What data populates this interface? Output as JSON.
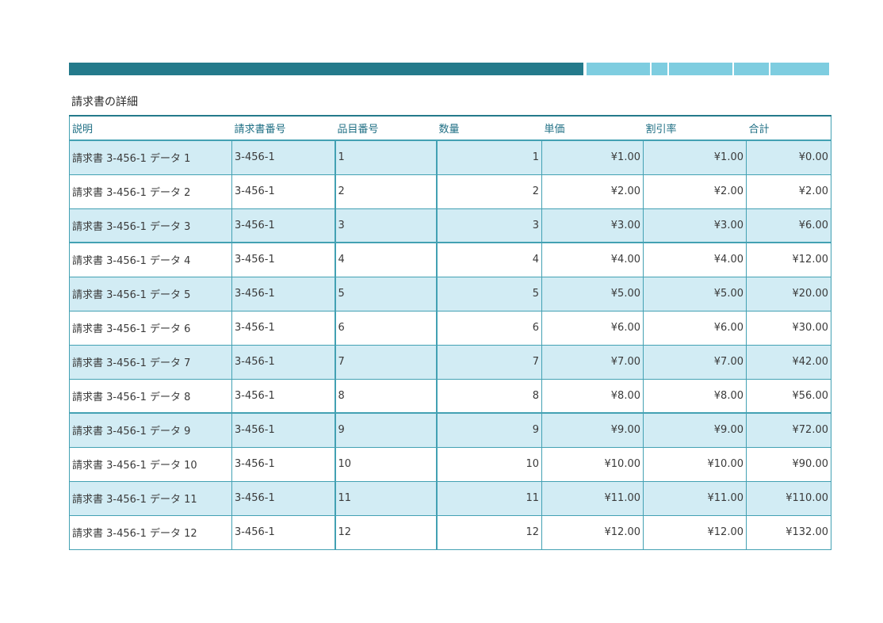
{
  "section": {
    "title": "請求書の詳細"
  },
  "table": {
    "headers": [
      "説明",
      "請求書番号",
      "品目番号",
      "数量",
      "単価",
      "割引率",
      "合計"
    ],
    "rows": [
      [
        "請求書 3-456-1 データ 1",
        "3-456-1",
        "1",
        "1",
        "¥1.00",
        "¥1.00",
        "¥0.00"
      ],
      [
        "請求書 3-456-1 データ 2",
        "3-456-1",
        "2",
        "2",
        "¥2.00",
        "¥2.00",
        "¥2.00"
      ],
      [
        "請求書 3-456-1 データ 3",
        "3-456-1",
        "3",
        "3",
        "¥3.00",
        "¥3.00",
        "¥6.00"
      ],
      [
        "請求書 3-456-1 データ 4",
        "3-456-1",
        "4",
        "4",
        "¥4.00",
        "¥4.00",
        "¥12.00"
      ],
      [
        "請求書 3-456-1 データ 5",
        "3-456-1",
        "5",
        "5",
        "¥5.00",
        "¥5.00",
        "¥20.00"
      ],
      [
        "請求書 3-456-1 データ 6",
        "3-456-1",
        "6",
        "6",
        "¥6.00",
        "¥6.00",
        "¥30.00"
      ],
      [
        "請求書 3-456-1 データ 7",
        "3-456-1",
        "7",
        "7",
        "¥7.00",
        "¥7.00",
        "¥42.00"
      ],
      [
        "請求書 3-456-1 データ 8",
        "3-456-1",
        "8",
        "8",
        "¥8.00",
        "¥8.00",
        "¥56.00"
      ],
      [
        "請求書 3-456-1 データ 9",
        "3-456-1",
        "9",
        "9",
        "¥9.00",
        "¥9.00",
        "¥72.00"
      ],
      [
        "請求書 3-456-1 データ 10",
        "3-456-1",
        "10",
        "10",
        "¥10.00",
        "¥10.00",
        "¥90.00"
      ],
      [
        "請求書 3-456-1 データ 11",
        "3-456-1",
        "11",
        "11",
        "¥11.00",
        "¥11.00",
        "¥110.00"
      ],
      [
        "請求書 3-456-1 データ 12",
        "3-456-1",
        "12",
        "12",
        "¥12.00",
        "¥12.00",
        "¥132.00"
      ]
    ]
  },
  "colors": {
    "accent_dark": "#247a8b",
    "accent_light": "#7ecde0",
    "band": "#d2ecf4",
    "border": "#43a1b3"
  }
}
